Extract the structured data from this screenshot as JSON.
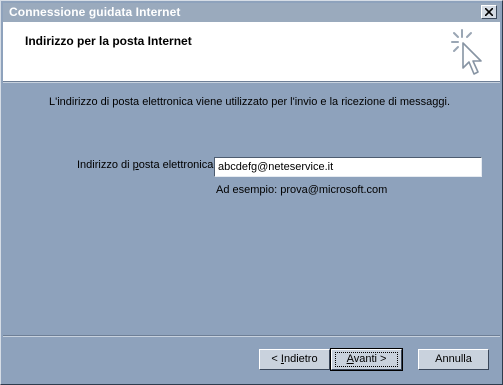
{
  "window": {
    "title": "Connessione guidata Internet"
  },
  "header": {
    "title": "Indirizzo per la posta Internet",
    "icon": "wizard-sparkle-cursor-icon"
  },
  "main": {
    "description": "L'indirizzo di posta elettronica viene utilizzato per l'invio e la ricezione di messaggi.",
    "email_label": "Indirizzo di posta elettronica:",
    "email_value": "abcdefg@neteservice.it",
    "example_text": "Ad esempio: prova@microsoft.com"
  },
  "buttons": {
    "back_label": "< Indietro",
    "next_label": "Avanti >",
    "cancel_label": "Annulla"
  },
  "colors": {
    "background": "#8ea2bc",
    "titlebar": "#9aaabd",
    "header_bg": "#ffffff",
    "button_face": "#c9d2dd"
  }
}
